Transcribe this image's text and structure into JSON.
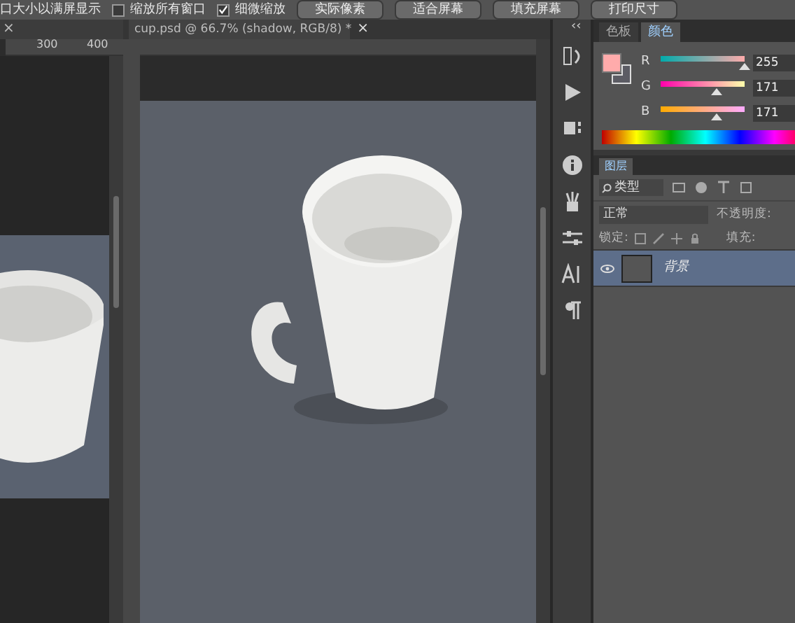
{
  "options_bar": {
    "cut_label": "口大小以满屏显示",
    "checkboxes": [
      {
        "label": "缩放所有窗口",
        "checked": false
      },
      {
        "label": "细微缩放",
        "checked": true
      }
    ],
    "buttons": [
      "实际像素",
      "适合屏幕",
      "填充屏幕",
      "打印尺寸"
    ]
  },
  "left_document": {
    "close": "×",
    "ruler_ticks": [
      "300",
      "400"
    ]
  },
  "document_tab": {
    "title": "cup.psd @ 66.7% (shadow, RGB/8) *",
    "close": "×"
  },
  "panel_collapse": "‹‹",
  "color_panel": {
    "tabs": [
      {
        "label": "色板",
        "selected": false
      },
      {
        "label": "颜色",
        "selected": true
      }
    ],
    "channels": [
      {
        "name": "R",
        "level": 1.0,
        "value": "255"
      },
      {
        "name": "G",
        "level": 0.67,
        "value": "171"
      },
      {
        "name": "B",
        "level": 0.67,
        "value": "171"
      }
    ]
  },
  "layers_panel": {
    "tab": "图层",
    "filter": "类型",
    "blend_mode": "正常",
    "opacity_label": "不透明度:",
    "lock_label": "锁定:",
    "fill_label": "填充:",
    "layers": [
      {
        "name": "背景",
        "visible": true,
        "selected": true
      }
    ]
  }
}
